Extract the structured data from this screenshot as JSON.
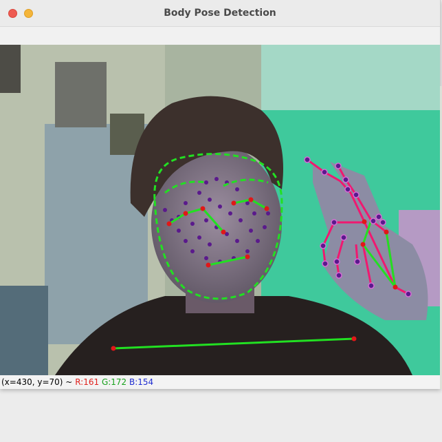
{
  "window": {
    "title": "Body Pose Detection",
    "controls": {
      "close": "close-button",
      "minimize": "minimize-button"
    }
  },
  "status": {
    "coords": "(x=430, y=70) ~",
    "r": "R:161",
    "g": "G:172",
    "b": "B:154"
  },
  "colors": {
    "landmark_point": "#5a1a8c",
    "face_outline": "#22e022",
    "joint": "#e01818",
    "hand_bone": "#f01870",
    "wall_green": "#3dc89a"
  }
}
